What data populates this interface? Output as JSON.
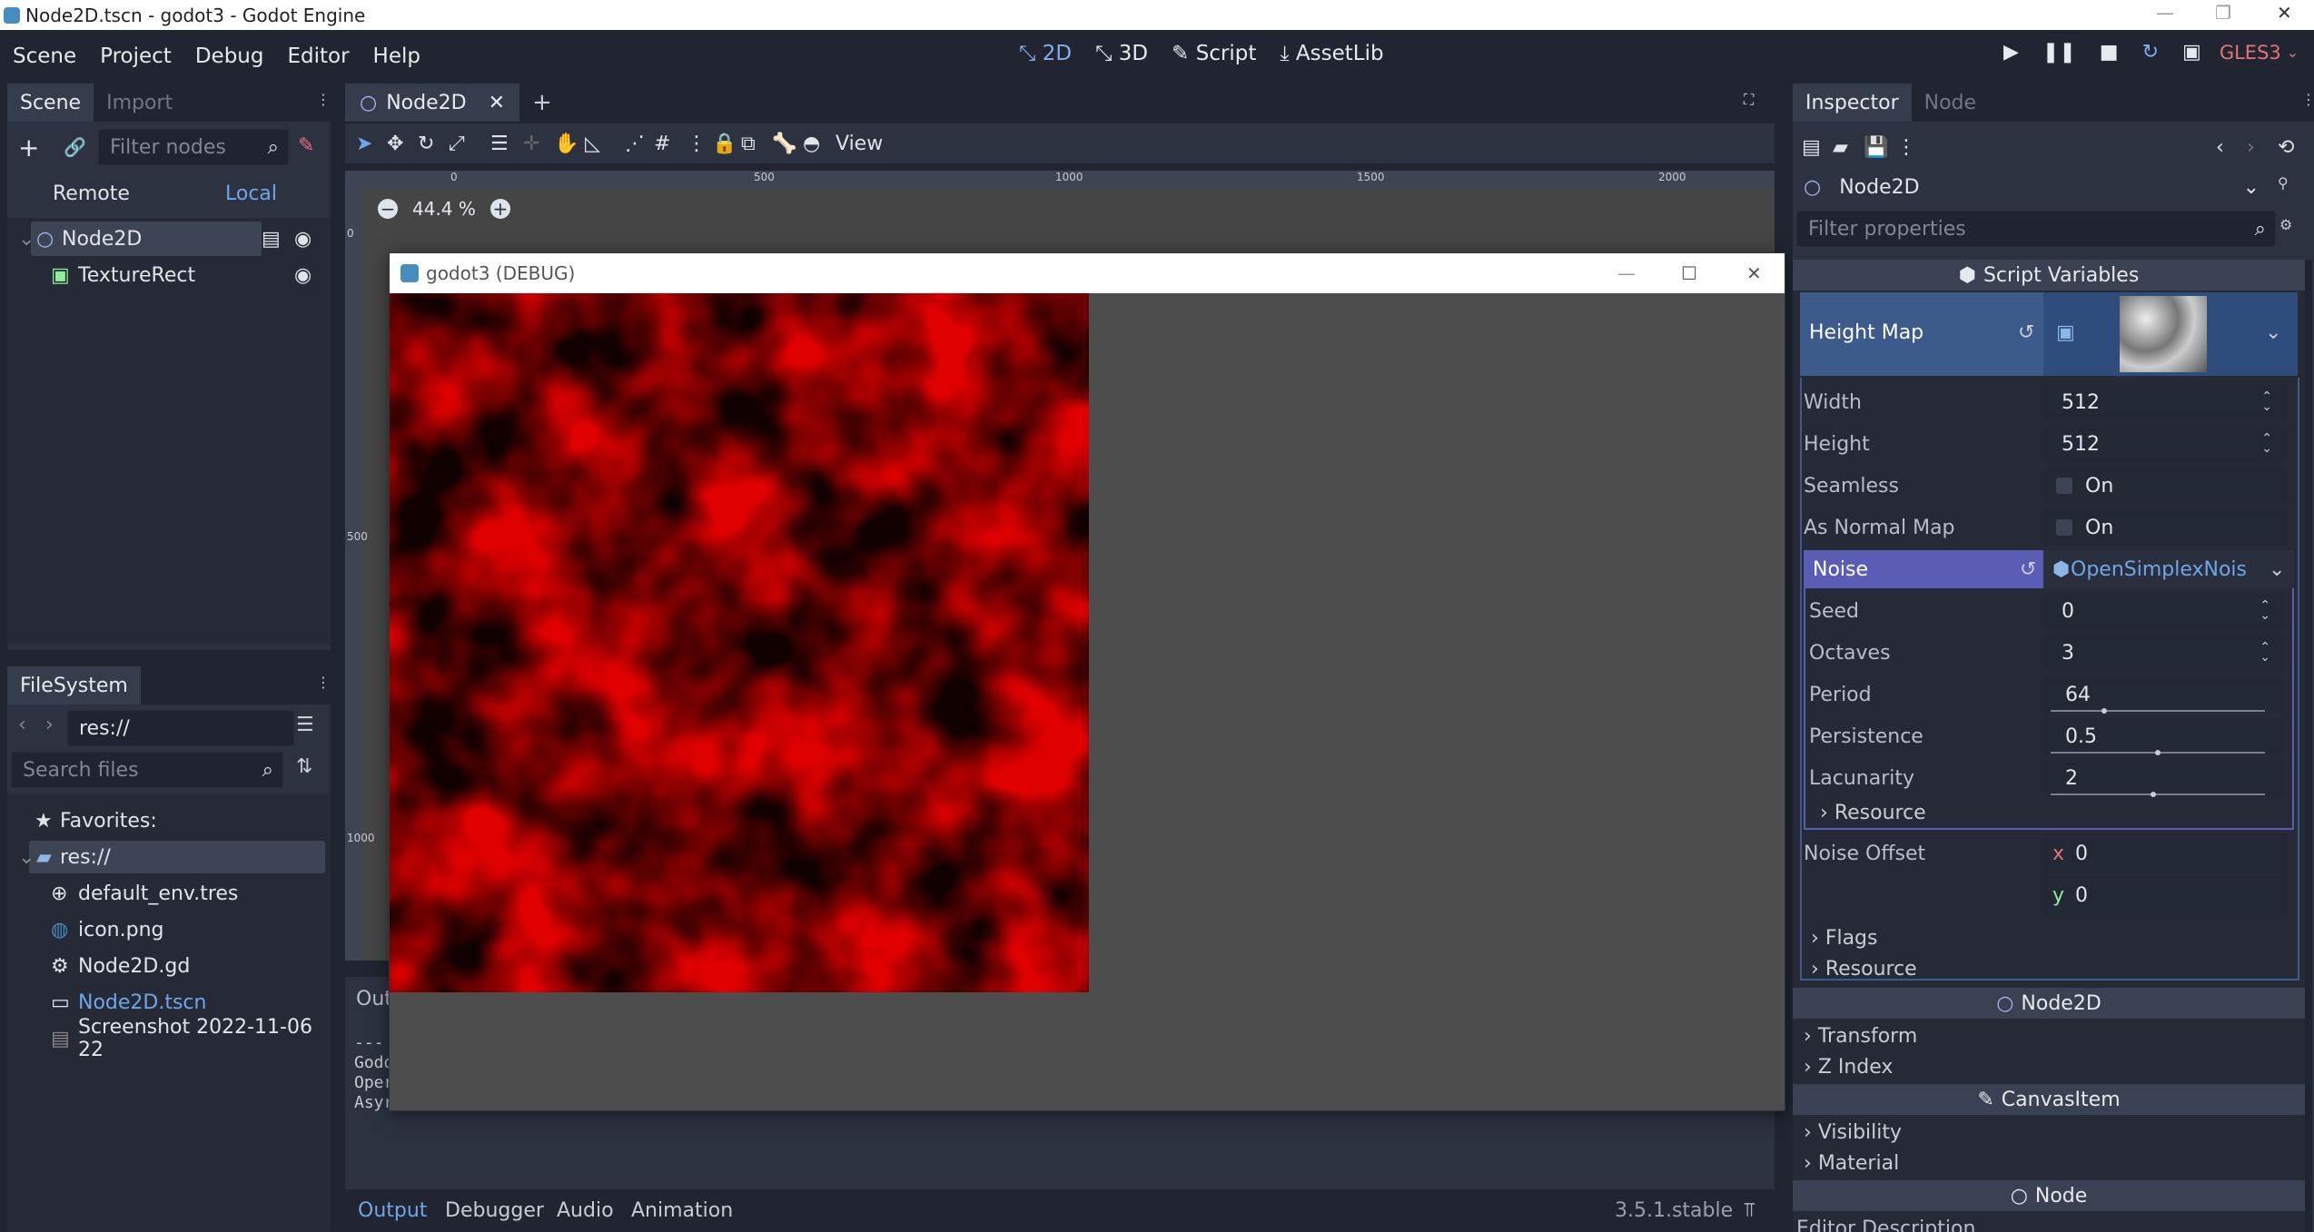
{
  "window": {
    "title": "Node2D.tscn - godot3 - Godot Engine",
    "controls": [
      "—",
      "❐",
      "✕"
    ]
  },
  "menu": {
    "items": [
      "Scene",
      "Project",
      "Debug",
      "Editor",
      "Help"
    ],
    "workspaces": {
      "w2d": "2D",
      "w3d": "3D",
      "script": "Script",
      "assetlib": "AssetLib"
    },
    "renderer": "GLES3"
  },
  "scene_dock": {
    "tab_scene": "Scene",
    "tab_import": "Import",
    "filter_placeholder": "Filter nodes",
    "remote": "Remote",
    "local": "Local",
    "nodes": [
      "Node2D",
      "TextureRect"
    ]
  },
  "filesystem": {
    "tab": "FileSystem",
    "path": "res://",
    "search_placeholder": "Search files",
    "favorites": "Favorites:",
    "root": "res://",
    "files": [
      "default_env.tres",
      "icon.png",
      "Node2D.gd",
      "Node2D.tscn",
      "Screenshot 2022-11-06 22"
    ]
  },
  "editor": {
    "scene_tab": "Node2D",
    "view_menu": "View",
    "zoom": "44.4 %",
    "ruler_h": [
      "0",
      "500",
      "1000",
      "1500",
      "2000"
    ],
    "ruler_v": [
      "0",
      "500",
      "1000"
    ],
    "output_partial": "Out",
    "log_partial": [
      "---",
      "Godo",
      "Oper",
      "Asyr"
    ]
  },
  "debug_window": {
    "title": "godot3 (DEBUG)",
    "controls": [
      "—",
      "☐",
      "✕"
    ]
  },
  "bottom_tabs": {
    "items": [
      "Output",
      "Debugger",
      "Audio",
      "Animation"
    ],
    "version": "3.5.1.stable"
  },
  "inspector": {
    "tab_inspector": "Inspector",
    "tab_node": "Node",
    "object": "Node2D",
    "filter_placeholder": "Filter properties",
    "script_variables": "Script Variables",
    "height_map": "Height Map",
    "width_label": "Width",
    "width": "512",
    "height_label": "Height",
    "height": "512",
    "seamless_label": "Seamless",
    "seamless": "On",
    "normal_label": "As Normal Map",
    "normal": "On",
    "noise_label": "Noise",
    "noise_value": "OpenSimplexNois",
    "seed_label": "Seed",
    "seed": "0",
    "octaves_label": "Octaves",
    "octaves": "3",
    "period_label": "Period",
    "period": "64",
    "period_fraction": 0.25,
    "persistence_label": "Persistence",
    "persistence": "0.5",
    "persistence_fraction": 0.5,
    "lacunarity_label": "Lacunarity",
    "lacunarity": "2",
    "lacunarity_fraction": 0.48,
    "resource_inner": "Resource",
    "noise_offset_label": "Noise Offset",
    "offset_x_axis": "x",
    "offset_x": "0",
    "offset_y_axis": "y",
    "offset_y": "0",
    "flags": "Flags",
    "resource": "Resource",
    "node2d_section": "Node2D",
    "transform": "Transform",
    "zindex": "Z Index",
    "canvasitem_section": "CanvasItem",
    "visibility": "Visibility",
    "material": "Material",
    "node_section": "Node",
    "editor_description": "Editor Description"
  },
  "colors": {
    "accent": "#6ea6e8",
    "bg": "#202531",
    "panel": "#2c3240",
    "noise_red": "#e00000"
  }
}
